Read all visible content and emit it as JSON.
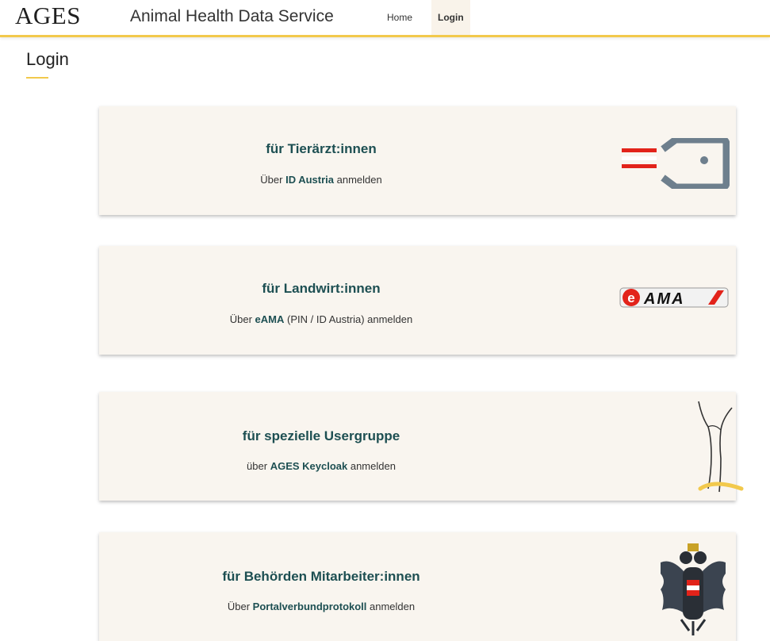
{
  "header": {
    "logo": "AGES",
    "app_title": "Animal Health Data Service",
    "nav": {
      "home": "Home",
      "login": "Login"
    }
  },
  "page": {
    "title": "Login"
  },
  "cards": [
    {
      "title": "für Tierärzt:innen",
      "sub_prefix": "Über ",
      "sub_bold": "ID Austria",
      "sub_suffix": " anmelden",
      "logo_icon": "id-austria-logo"
    },
    {
      "title": "für Landwirt:innen",
      "sub_prefix": "Über ",
      "sub_bold": "eAMA",
      "sub_suffix": " (PIN / ID Austria) anmelden",
      "logo_icon": "eama-logo",
      "logo_text_e": "e",
      "logo_text": "AMA"
    },
    {
      "title": "für spezielle Usergruppe",
      "sub_prefix": "über ",
      "sub_bold": "AGES Keycloak",
      "sub_suffix": " anmelden",
      "logo_icon": "ages-figure-logo"
    },
    {
      "title": "für Behörden Mitarbeiter:innen",
      "sub_prefix": "Über ",
      "sub_bold": "Portalverbundprotokoll",
      "sub_suffix": " anmelden",
      "logo_icon": "austrian-eagle-logo"
    }
  ],
  "colors": {
    "accent": "#f2c94c",
    "title_teal": "#1d4f52",
    "card_bg": "#f9f5ef",
    "austria_red": "#e2231a"
  }
}
